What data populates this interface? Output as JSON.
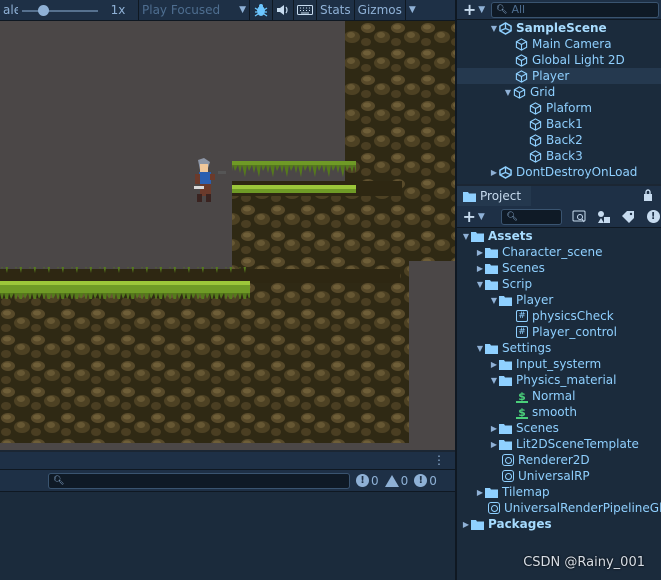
{
  "game_toolbar": {
    "scale_label": "ale",
    "scale_value": "1x",
    "play_mode": "Play Focused",
    "stats": "Stats",
    "gizmos": "Gizmos"
  },
  "hierarchy": {
    "search_placeholder": "All",
    "items": [
      {
        "label": "SampleScene"
      },
      {
        "label": "Main Camera"
      },
      {
        "label": "Global Light 2D"
      },
      {
        "label": "Player"
      },
      {
        "label": "Grid"
      },
      {
        "label": "Plaform"
      },
      {
        "label": "Back1"
      },
      {
        "label": "Back2"
      },
      {
        "label": "Back3"
      },
      {
        "label": "DontDestroyOnLoad"
      }
    ]
  },
  "project": {
    "tab": "Project",
    "items": [
      {
        "label": "Assets"
      },
      {
        "label": "Character_scene"
      },
      {
        "label": "Scenes"
      },
      {
        "label": "Scrip"
      },
      {
        "label": "Player"
      },
      {
        "label": "physicsCheck"
      },
      {
        "label": "Player_control"
      },
      {
        "label": "Settings"
      },
      {
        "label": "Input_systerm"
      },
      {
        "label": "Physics_material"
      },
      {
        "label": "Normal"
      },
      {
        "label": "smooth"
      },
      {
        "label": "Scenes"
      },
      {
        "label": "Lit2DSceneTemplate"
      },
      {
        "label": "Renderer2D"
      },
      {
        "label": "UniversalRP"
      },
      {
        "label": "Tilemap"
      },
      {
        "label": "UniversalRenderPipelineGlo"
      },
      {
        "label": "Packages"
      }
    ]
  },
  "console": {
    "error_count": "0",
    "warning_count": "0",
    "info_count": "0"
  },
  "watermark": "CSDN @Rainy_001",
  "colors": {
    "panel_bg": "#1b2b3c",
    "toolbar_bg": "#1e3046",
    "accent_text": "#8fd0ff",
    "grass": "#7ea530",
    "dirt": "#3a3019",
    "sky": "#4b4747"
  }
}
